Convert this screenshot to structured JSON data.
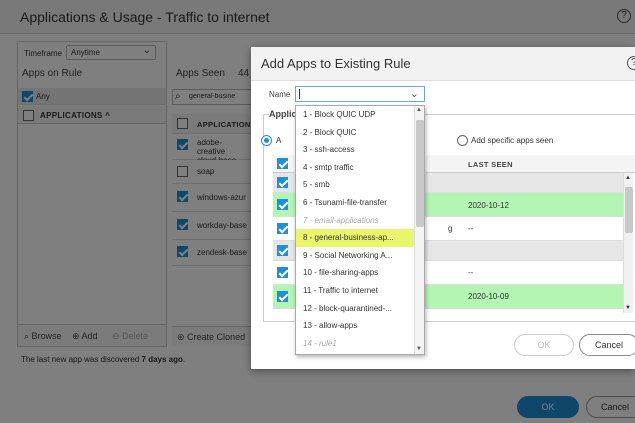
{
  "background": {
    "title": "Applications & Usage - Traffic to internet",
    "timeframe_label": "Timeframe",
    "timeframe_value": "Anytime",
    "apps_on_rule_label": "Apps on Rule",
    "any_label": "Any",
    "applications_header": "APPLICATIONS",
    "browse_label": "Browse",
    "add_label": "Add",
    "delete_label": "Delete",
    "last_new_prefix": "The last new app was discovered ",
    "last_new_bold": "7 days ago",
    "last_new_suffix": ".",
    "apps_seen_label": "Apps Seen",
    "apps_seen_count": "44",
    "search_value": "general-busine",
    "applications_header_mid": "APPLICATION",
    "mid_rows": [
      "adobe-creative cloud-base",
      "soap",
      "windows-azur",
      "workday-base",
      "zendesk-base"
    ],
    "create_cloned_label": "Create Cloned",
    "ok_label": "OK",
    "cancel_label": "Cancel"
  },
  "modal": {
    "title": "Add Apps to Existing Rule",
    "name_label": "Name",
    "name_value": "",
    "legend": "Applic",
    "radio_all_label": "A",
    "radio_specific_label": "Add specific apps seen",
    "col_last_seen": "LAST SEEN",
    "rows": [
      {
        "type": "group",
        "last_seen": ""
      },
      {
        "type": "green",
        "last_seen": "2020-10-12"
      },
      {
        "type": "white",
        "last_seen": "--",
        "extra": "g"
      },
      {
        "type": "group",
        "last_seen": ""
      },
      {
        "type": "white",
        "last_seen": "--"
      },
      {
        "type": "green",
        "last_seen": "2020-10-09"
      }
    ],
    "ok_label": "OK",
    "cancel_label": "Cancel"
  },
  "dropdown": {
    "items": [
      {
        "label": "1 - Block QUIC UDP",
        "disabled": false
      },
      {
        "label": "2 - Block QUIC",
        "disabled": false
      },
      {
        "label": "3 - ssh-access",
        "disabled": false
      },
      {
        "label": "4 - smtp traffic",
        "disabled": false
      },
      {
        "label": "5 - smb",
        "disabled": false
      },
      {
        "label": "6 - Tsunami-file-transfer",
        "disabled": false
      },
      {
        "label": "7 - email-applications",
        "disabled": true
      },
      {
        "label": "8 - general-business-ap...",
        "disabled": false,
        "highlighted": true
      },
      {
        "label": "9 - Social Networking A...",
        "disabled": false
      },
      {
        "label": "10 - file-sharing-apps",
        "disabled": false
      },
      {
        "label": "11 - Traffic to internet",
        "disabled": false
      },
      {
        "label": "12 - block-quarantined-...",
        "disabled": false
      },
      {
        "label": "13 - allow-apps",
        "disabled": false
      },
      {
        "label": "14 - rule1",
        "disabled": true
      }
    ]
  },
  "colors": {
    "accent": "#1f8fd6",
    "highlight": "#e9f56a",
    "green_row": "#b3f5b3"
  }
}
